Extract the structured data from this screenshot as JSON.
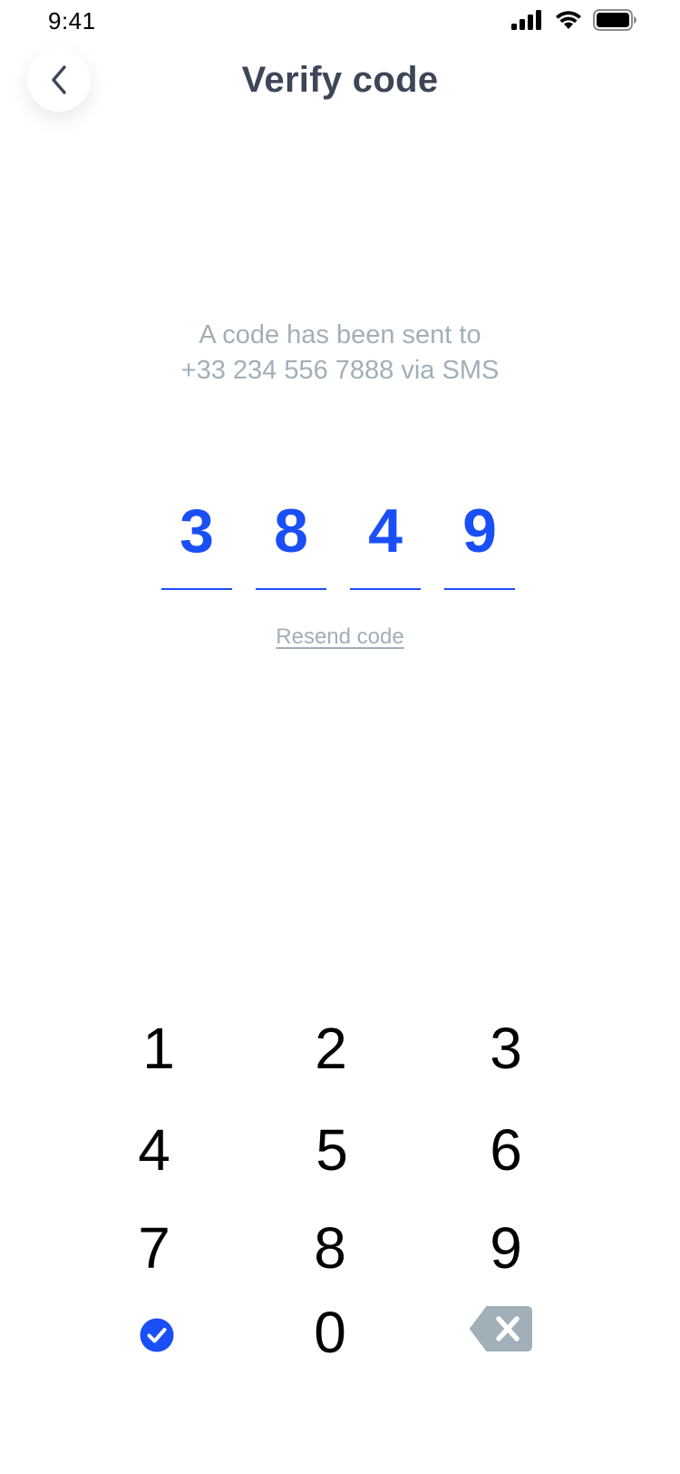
{
  "status_bar": {
    "time": "9:41",
    "icons": [
      "cellular-signal-icon",
      "wifi-icon",
      "battery-icon"
    ]
  },
  "header": {
    "back_icon": "chevron-left-icon",
    "title": "Verify code"
  },
  "message": {
    "line1": "A code has been sent to",
    "line2": "+33 234 556 7888 via SMS"
  },
  "code": {
    "digits": [
      "3",
      "8",
      "4",
      "9"
    ]
  },
  "resend_label": "Resend code",
  "keypad": {
    "keys": [
      "1",
      "2",
      "3",
      "4",
      "5",
      "6",
      "7",
      "8",
      "9",
      "0"
    ],
    "confirm_icon": "check-circle-icon",
    "delete_icon": "backspace-icon"
  },
  "colors": {
    "accent": "#1a4ff5",
    "title": "#3d4658",
    "muted": "#a1afb9",
    "delete_key": "#a1afb9"
  }
}
